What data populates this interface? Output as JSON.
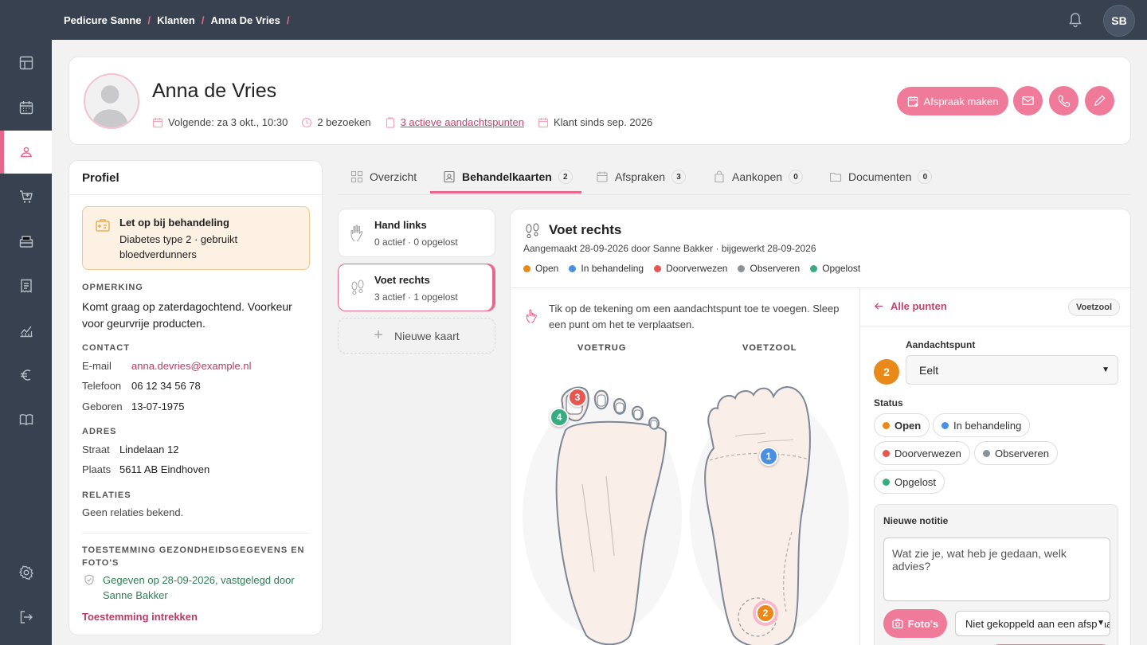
{
  "breadcrumb": [
    "Pedicure Sanne",
    "Klanten",
    "Anna De Vries"
  ],
  "user_initials": "SB",
  "client": {
    "name": "Anna de Vries",
    "next": "Volgende: za 3 okt., 10:30",
    "visits": "2 bezoeken",
    "active_points": "3 actieve aandachtspunten",
    "since": "Klant sinds sep. 2026"
  },
  "header_actions": {
    "appointment": "Afspraak maken"
  },
  "profile": {
    "title": "Profiel",
    "alert_title": "Let op bij behandeling",
    "alert_text": "Diabetes type 2 · gebruikt bloedverdunners",
    "remark_head": "OPMERKING",
    "remark": "Komt graag op zaterdagochtend. Voorkeur voor geurvrije producten.",
    "contact_head": "CONTACT",
    "email_label": "E-mail",
    "email": "anna.devries@example.nl",
    "phone_label": "Telefoon",
    "phone": "06 12 34 56 78",
    "born_label": "Geboren",
    "born": "13-07-1975",
    "address_head": "ADRES",
    "street_label": "Straat",
    "street": "Lindelaan 12",
    "city_label": "Plaats",
    "city": "5611 AB Eindhoven",
    "relations_head": "RELATIES",
    "relations": "Geen relaties bekend.",
    "consent_head": "TOESTEMMING GEZONDHEIDSGEGEVENS EN FOTO'S",
    "consent": "Gegeven op 28-09-2026, vastgelegd door Sanne Bakker",
    "revoke": "Toestemming intrekken"
  },
  "tabs": [
    {
      "label": "Overzicht",
      "count": ""
    },
    {
      "label": "Behandelkaarten",
      "count": "2"
    },
    {
      "label": "Afspraken",
      "count": "3"
    },
    {
      "label": "Aankopen",
      "count": "0"
    },
    {
      "label": "Documenten",
      "count": "0"
    }
  ],
  "cards": [
    {
      "name": "Hand links",
      "sub": "0 actief · 0 opgelost"
    },
    {
      "name": "Voet rechts",
      "sub": "3 actief · 1 opgelost"
    }
  ],
  "new_card": "Nieuwe kaart",
  "map": {
    "title": "Voet rechts",
    "sub": "Aangemaakt 28-09-2026 door Sanne Bakker · bijgewerkt 28-09-2026",
    "hint": "Tik op de tekening om een aandachtspunt toe te voegen. Sleep een punt om het te verplaatsen.",
    "back_label": "VOETRUG",
    "sole_label": "VOETZOOL",
    "markers": [
      "1",
      "2",
      "3",
      "4"
    ]
  },
  "legend": [
    {
      "label": "Open",
      "color": "#e8891a"
    },
    {
      "label": "In behandeling",
      "color": "#4a90e2"
    },
    {
      "label": "Doorverwezen",
      "color": "#e8574f"
    },
    {
      "label": "Observeren",
      "color": "#8a9198"
    },
    {
      "label": "Opgelost",
      "color": "#3aaa80"
    }
  ],
  "detail": {
    "back": "Alle punten",
    "chip": "Voetzool",
    "point_label": "Aandachtspunt",
    "point_num": "2",
    "point_value": "Eelt",
    "status_label": "Status",
    "statuses": [
      "Open",
      "In behandeling",
      "Doorverwezen",
      "Observeren",
      "Opgelost"
    ],
    "note_label": "Nieuwe notitie",
    "note_placeholder": "Wat zie je, wat heb je gedaan, welk advies?",
    "photos": "Foto's",
    "link_select": "Niet gekoppeld aan een afspraak"
  }
}
